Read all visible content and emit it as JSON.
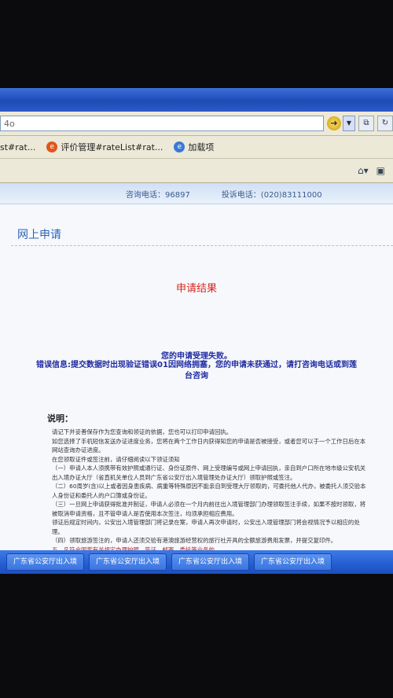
{
  "browser": {
    "address_text": "4o",
    "favorites": [
      {
        "label": "st#rat...",
        "icon": "page-icon"
      },
      {
        "label": "评价管理#rateList#rat...",
        "icon": "favorite-page-icon"
      },
      {
        "label": "加载项",
        "icon": "addon-icon"
      }
    ]
  },
  "banner": {
    "left": "咨询电话：96897",
    "right": "投诉电话：(020)83111000"
  },
  "page": {
    "title": "网上申请",
    "result_title": "申请结果",
    "fail_message": "您的申请受理失败。",
    "error_message": "错误信息:提交数据时出现验证错误01因网络拥塞，您的申请未获通过，请打咨询电话或到莲台咨询",
    "note_heading": "说明：",
    "notes": [
      "请记下并妥善保存作为您查询和领证的依据，您也可以打印申请回执。",
      "如您选择了手机短信发送办证进度业务，您将在两个工作日内获得知您的申请是否被接受，或者您可以于一个工作日后在本网站查询办证进度。",
      "在您领取证件或签注前，请仔细阅读以下领证须知",
      "（一）申请人本人须携带有效护照或通行证、身份证原件、网上受理编号或网上申请回执，亲自到户口所在地市级公安机关出入境办证大厅（省直机关单位人员到广东省公安厅出入境管理处办证大厅）领取护照或签注。",
      "（二）60周岁(含)以上或者因身患疾病、病重等特殊原因不能亲自到受理大厅领取的，可委托他人代办，被委托人须交验本人身份证和委托人的户口簿或身份证。",
      "（三）一旦网上申请获得批准并制证，申请人必须在一个月内前往出入境管理部门办理领取签注手续，如果不按时领取，将被取消申请资格，且不管申请人是否使用本次签注，均须承担相应费用。",
      "领证后规定时间内，公安出入境管理部门将记录在案，申请人再次申请时，公安出入境管理部门将会视情况予以相应的处理。",
      "（四）领取旅游签注的，申请人还须交验有港澳旅游经营权的旅行社开具的全额旅游费用发票，并提交复印件。",
      "五、凡符合国家有关规定办理护照、签证、邮寄、委托等业务的"
    ]
  },
  "taskbar": {
    "items": [
      "广东省公安厅出入境",
      "广东省公安厅出入境",
      "广东省公安厅出入境",
      "广东省公安厅出入境"
    ]
  },
  "colors": {
    "titlebar": "#1e4bb5",
    "page_title": "#2b64b8",
    "result_title": "#d9241b",
    "message": "#1f2ba0"
  }
}
